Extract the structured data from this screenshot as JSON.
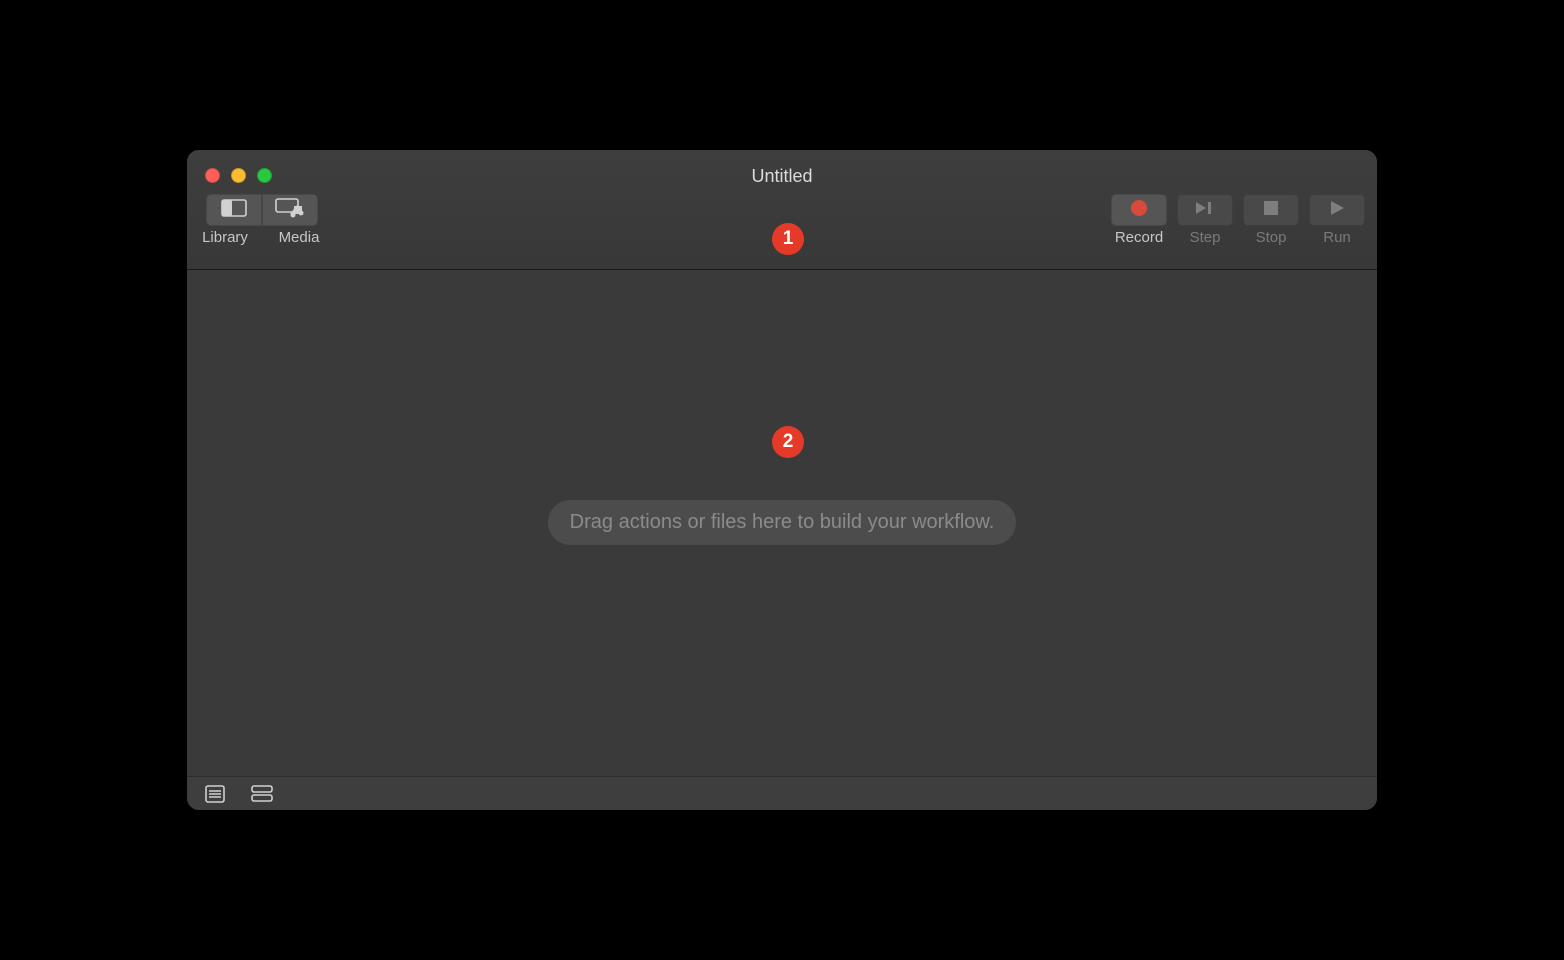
{
  "window": {
    "title": "Untitled"
  },
  "toolbar": {
    "library_label": "Library",
    "media_label": "Media",
    "record_label": "Record",
    "step_label": "Step",
    "stop_label": "Stop",
    "run_label": "Run"
  },
  "workflow": {
    "placeholder": "Drag actions or files here to build your workflow."
  },
  "callouts": {
    "one": "1",
    "two": "2"
  }
}
